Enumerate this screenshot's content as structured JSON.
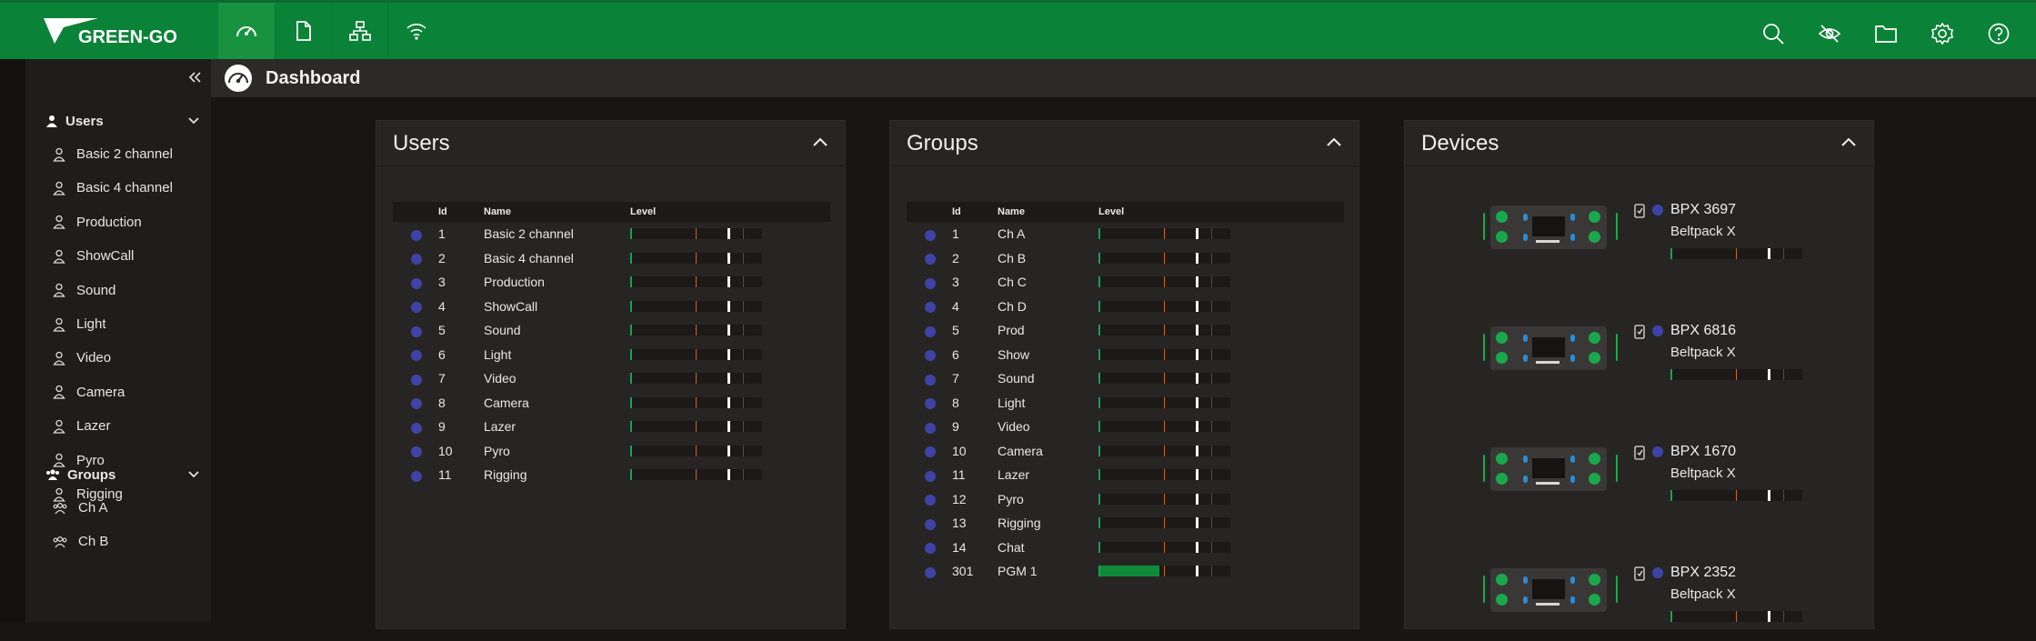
{
  "brand": {
    "name": "GREEN-GO",
    "accent": "#0a8237"
  },
  "nav_tabs": [
    {
      "icon": "dashboard-icon",
      "active": true
    },
    {
      "icon": "document-icon",
      "active": false
    },
    {
      "icon": "network-icon",
      "active": false
    },
    {
      "icon": "wireless-icon",
      "active": false
    }
  ],
  "top_actions": [
    "search-icon",
    "hidden-eye-icon",
    "folder-icon",
    "gear-icon",
    "help-icon"
  ],
  "page": {
    "title": "Dashboard"
  },
  "sidebar": {
    "users_section": "Users",
    "users": [
      "Basic 2 channel",
      "Basic 4 channel",
      "Production",
      "ShowCall",
      "Sound",
      "Light",
      "Video",
      "Camera",
      "Lazer",
      "Pyro",
      "Rigging"
    ],
    "groups_section": "Groups",
    "groups": [
      "Ch A",
      "Ch B"
    ]
  },
  "users_card": {
    "title": "Users",
    "columns": [
      "Id",
      "Name",
      "Level"
    ],
    "rows": [
      {
        "id": "1",
        "name": "Basic 2 channel",
        "level": 0
      },
      {
        "id": "2",
        "name": "Basic 4 channel",
        "level": 0
      },
      {
        "id": "3",
        "name": "Production",
        "level": 0
      },
      {
        "id": "4",
        "name": "ShowCall",
        "level": 0
      },
      {
        "id": "5",
        "name": "Sound",
        "level": 0
      },
      {
        "id": "6",
        "name": "Light",
        "level": 0
      },
      {
        "id": "7",
        "name": "Video",
        "level": 0
      },
      {
        "id": "8",
        "name": "Camera",
        "level": 0
      },
      {
        "id": "9",
        "name": "Lazer",
        "level": 0
      },
      {
        "id": "10",
        "name": "Pyro",
        "level": 0
      },
      {
        "id": "11",
        "name": "Rigging",
        "level": 0
      }
    ]
  },
  "groups_card": {
    "title": "Groups",
    "columns": [
      "Id",
      "Name",
      "Level"
    ],
    "rows": [
      {
        "id": "1",
        "name": "Ch A",
        "level": 0
      },
      {
        "id": "2",
        "name": "Ch B",
        "level": 0
      },
      {
        "id": "3",
        "name": "Ch C",
        "level": 0
      },
      {
        "id": "4",
        "name": "Ch D",
        "level": 0
      },
      {
        "id": "5",
        "name": "Prod",
        "level": 0
      },
      {
        "id": "6",
        "name": "Show",
        "level": 0
      },
      {
        "id": "7",
        "name": "Sound",
        "level": 0
      },
      {
        "id": "8",
        "name": "Light",
        "level": 0
      },
      {
        "id": "9",
        "name": "Video",
        "level": 0
      },
      {
        "id": "10",
        "name": "Camera",
        "level": 0
      },
      {
        "id": "11",
        "name": "Lazer",
        "level": 0
      },
      {
        "id": "12",
        "name": "Pyro",
        "level": 0
      },
      {
        "id": "13",
        "name": "Rigging",
        "level": 0
      },
      {
        "id": "14",
        "name": "Chat",
        "level": 0
      },
      {
        "id": "301",
        "name": "PGM 1",
        "level": 0.46
      }
    ]
  },
  "devices_card": {
    "title": "Devices",
    "devices": [
      {
        "name": "BPX 3697",
        "type": "Beltpack X"
      },
      {
        "name": "BPX 6816",
        "type": "Beltpack X"
      },
      {
        "name": "BPX 1670",
        "type": "Beltpack X"
      },
      {
        "name": "BPX 2352",
        "type": "Beltpack X"
      }
    ]
  },
  "colors": {
    "user_dot": "#3e44a6",
    "meter_green": "#0f8a3a",
    "meter_orange": "#c86a1a",
    "meter_red": "#b81e1e"
  }
}
